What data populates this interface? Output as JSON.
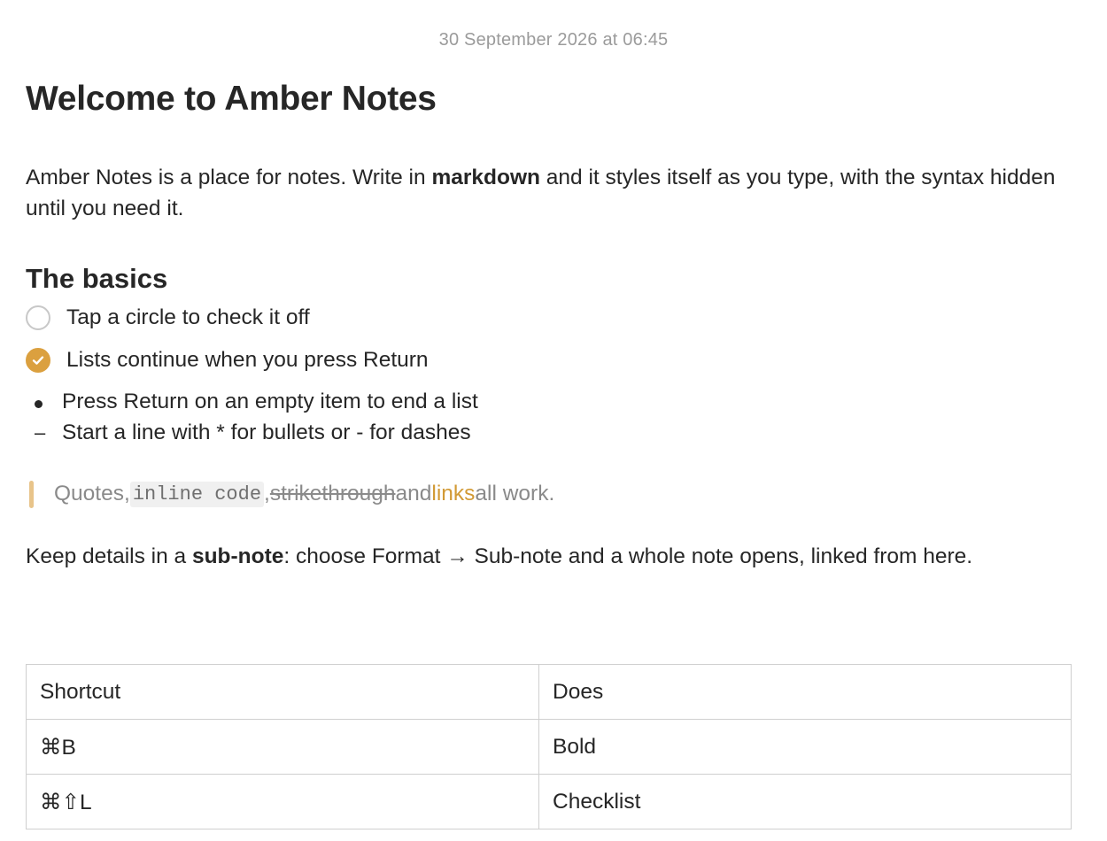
{
  "note": {
    "timestamp": "30 September 2026 at 06:45",
    "title": "Welcome to Amber Notes",
    "intro": {
      "before": "Amber Notes is a place for notes. Write in ",
      "bold": "markdown",
      "after": " and it styles itself as you type, with the syntax hidden until you need it."
    },
    "basics_heading": "The basics",
    "checklist": [
      {
        "label": "Tap a circle to check it off",
        "checked": false
      },
      {
        "label": "Lists continue when you press Return",
        "checked": true
      }
    ],
    "bullets": [
      {
        "marker": "bullet",
        "label": "Press Return on an empty item to end a list"
      },
      {
        "marker": "dash",
        "marker_text": "–",
        "label": "Start a line with * for bullets or - for dashes"
      }
    ],
    "quote": {
      "part1": "Quotes, ",
      "code": "inline code",
      "part2": ", ",
      "strike": "strikethrough",
      "part3": " and ",
      "link": "links",
      "part4": " all work."
    },
    "subnote": {
      "before": "Keep details in a ",
      "bold": "sub-note",
      "after": ": choose Format → Sub-note and a whole note opens, linked from here."
    },
    "table": {
      "headers": [
        "Shortcut",
        "Does"
      ],
      "rows": [
        [
          "⌘B",
          "Bold"
        ],
        [
          "⌘⇧L",
          "Checklist"
        ]
      ]
    }
  },
  "colors": {
    "accent": "#dba03f",
    "link": "#d29a35",
    "text": "#262626",
    "muted": "#9b9b9b",
    "quote_bar": "#e8c48a"
  }
}
